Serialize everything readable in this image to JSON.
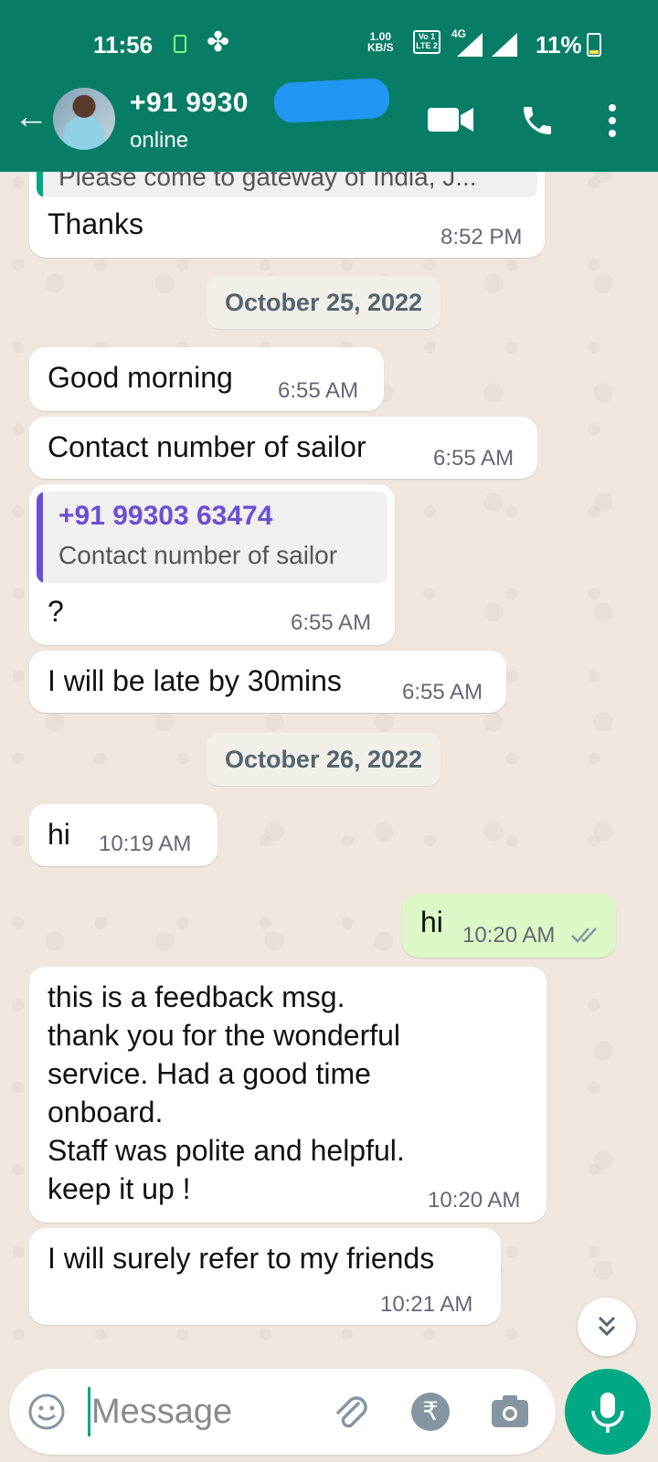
{
  "status_bar": {
    "time": "11:56",
    "fan_icon": "✤",
    "speed": "1.00\nKB/S",
    "volte": "Vo 1\nLTE 2",
    "net": "4G",
    "battery": "11%"
  },
  "header": {
    "contact_name": "+91 9930",
    "status": "online",
    "back_glyph": "←"
  },
  "messages": {
    "m0_quote": "Please come to gateway of India, J...",
    "m0_text": "Thanks",
    "m0_time": "8:52 PM",
    "date1": "October 25, 2022",
    "m1_text": "Good morning",
    "m1_time": "6:55 AM",
    "m2_text": "Contact number of sailor",
    "m2_time": "6:55 AM",
    "m3_quote_name": "+91 99303 63474",
    "m3_quote_text": "Contact number of sailor",
    "m3_text": "?",
    "m3_time": "6:55 AM",
    "m4_text": "I will be late by 30mins",
    "m4_time": "6:55 AM",
    "date2": "October 26, 2022",
    "m5_text": "hi",
    "m5_time": "10:19 AM",
    "m6_text": "hi",
    "m6_time": "10:20 AM",
    "m7_text": "this is a feedback msg.\nthank you for the wonderful\nservice. Had a good time\nonboard.\nStaff was polite and helpful.\nkeep it up !",
    "m7_time": "10:20 AM",
    "m8_text": "I will surely refer to my friends",
    "m8_time": "10:21 AM"
  },
  "composer": {
    "placeholder": "Message",
    "rupee": "₹"
  },
  "colors": {
    "header": "#077d66",
    "outgoing_bubble": "#dcf8c6",
    "accent": "#00a884",
    "quote_accent": "#6b4fd1"
  }
}
